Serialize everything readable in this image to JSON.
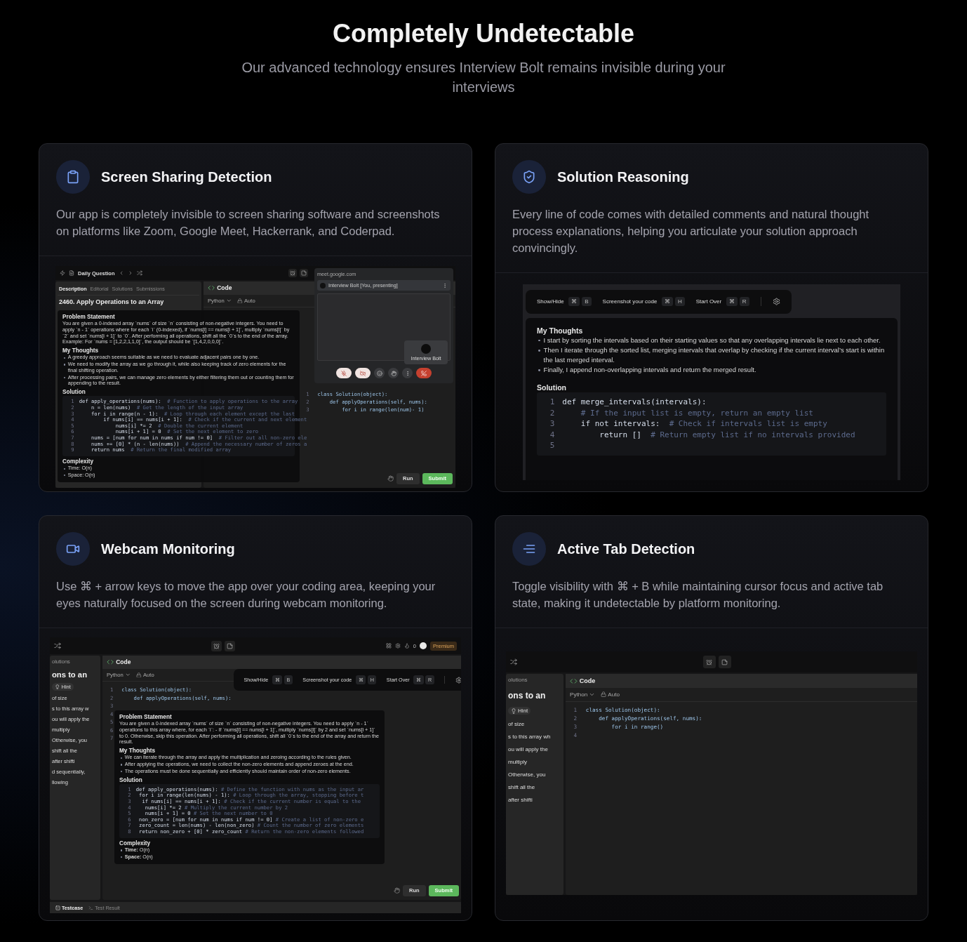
{
  "header": {
    "title": "Completely Undetectable",
    "subtitle": "Our advanced technology ensures Interview Bolt remains invisible during your interviews"
  },
  "cards": [
    {
      "title": "Screen Sharing Detection",
      "description": "Our app is completely invisible to screen sharing software and screenshots on platforms like Zoom, Google Meet, Hackerrank, and Coderpad.",
      "preview": {
        "kind": "meet",
        "app_title": "Daily Question",
        "tabs": [
          {
            "label": "Description",
            "selected": true
          },
          {
            "label": "Editorial",
            "selected": false
          },
          {
            "label": "Solutions",
            "selected": false
          },
          {
            "label": "Submissions",
            "selected": false
          }
        ],
        "problem_title": "2460. Apply Operations to an Array",
        "editor": {
          "title": "Code",
          "language": "Python",
          "mode": "Auto",
          "lines": [
            {
              "n": "1",
              "code": "class Solution(object):"
            },
            {
              "n": "2",
              "code": "    def applyOperations(self, nums):"
            },
            {
              "n": "3",
              "code": "        for i in range(len(num)- 1)"
            }
          ]
        },
        "sections": [
          {
            "kind": "text",
            "heading": "Problem Statement",
            "text": "You are given a 0-indexed array `nums` of size `n` consisting of non-negative integers. You need to apply `n - 1` operations where for each `i` (0-indexed), if `nums[i] == nums[i + 1]`, multiply `nums[i]` by `2` and set `nums[i + 1]` to `0`. After performing all operations, shift all the `0`s to the end of the array. Example: For `nums = [1,2,2,1,1,0]`, the output should be `[1,4,2,0,0,0]`."
          },
          {
            "kind": "bullets",
            "heading": "My Thoughts",
            "items": [
              "A greedy approach seems suitable as we need to evaluate adjacent pairs one by one.",
              "We need to modify the array as we go through it, while also keeping track of zero elements for the final shifting operation.",
              "After processing pairs, we can manage zero elements by either filtering them out or counting them for appending to the result."
            ]
          },
          {
            "kind": "code",
            "heading": "Solution",
            "lines": [
              {
                "n": "1",
                "code": "def apply_operations(nums):  ",
                "comment": "# Function to apply operations to the array"
              },
              {
                "n": "2",
                "code": "    n = len(nums)  ",
                "comment": "# Get the length of the input array"
              },
              {
                "n": "3",
                "code": "    for i in range(n - 1):  ",
                "comment": "# Loop through each element except the last"
              },
              {
                "n": "4",
                "code": "        if nums[i] == nums[i + 1]:  ",
                "comment": "# Check if the current and next element"
              },
              {
                "n": "5",
                "code": "            nums[i] *= 2  ",
                "comment": "# Double the current element"
              },
              {
                "n": "6",
                "code": "            nums[i + 1] = 0  ",
                "comment": "# Set the next element to zero"
              },
              {
                "n": "7",
                "code": "    nums = [num for num in nums if num != 0]  ",
                "comment": "# Filter out all non-zero ele"
              },
              {
                "n": "8",
                "code": "    nums += [0] * (n - len(nums))  ",
                "comment": "# Append the necessary number of zeros a"
              },
              {
                "n": "9",
                "code": "    return nums  ",
                "comment": "# Return the final modified array"
              }
            ]
          },
          {
            "kind": "bullets",
            "heading": "Complexity",
            "items": [
              "Time: O(n)",
              "Space: O(n)"
            ]
          }
        ],
        "meet": {
          "url": "meet.google.com",
          "presenting": "Interview Bolt [You, presenting]",
          "participant": "Interview Bolt"
        },
        "buttons": [
          {
            "label": "Run",
            "kind": "secondary"
          },
          {
            "label": "Submit",
            "kind": "primary"
          }
        ]
      }
    },
    {
      "title": "Solution Reasoning",
      "description": "Every line of code comes with detailed comments and natural thought process explanations, helping you articulate your solution approach convincingly.",
      "preview": {
        "kind": "reasoning",
        "shortcuts": [
          {
            "label": "Show/Hide",
            "keys": [
              "⌘",
              "B"
            ]
          },
          {
            "label": "Screenshot your code",
            "keys": [
              "⌘",
              "H"
            ]
          },
          {
            "label": "Start Over",
            "keys": [
              "⌘",
              "R"
            ]
          }
        ],
        "sections": [
          {
            "kind": "bullets",
            "heading": "My Thoughts",
            "items": [
              "I start by sorting the intervals based on their starting values so that any overlapping intervals lie next to each other.",
              "Then I iterate through the sorted list, merging intervals that overlap by checking if the current interval’s start is within the last merged interval.",
              "Finally, I append non-overlapping intervals and return the merged result."
            ]
          },
          {
            "kind": "code",
            "heading": "Solution",
            "lines": [
              {
                "n": "1",
                "code": "def merge_intervals(intervals):"
              },
              {
                "n": "2",
                "comment": "    # If the input list is empty, return an empty list"
              },
              {
                "n": "3",
                "code": "    if not intervals:  ",
                "comment": "# Check if intervals list is empty"
              },
              {
                "n": "4",
                "code": "        return []  ",
                "comment": "# Return empty list if no intervals provided"
              },
              {
                "n": "5"
              }
            ]
          }
        ]
      }
    },
    {
      "title": "Webcam Monitoring",
      "description": "Use ⌘ + arrow keys to move the app over your coding area, keeping your eyes naturally focused on the screen during webcam monitoring.",
      "preview": {
        "kind": "overlay",
        "count": "0",
        "premium": "Premium",
        "fragments": [
          {
            "kind": "tab",
            "text": "olutions"
          },
          {
            "kind": "heading",
            "text": "ons to an"
          },
          {
            "kind": "pill",
            "text": "Hint"
          },
          {
            "kind": "text",
            "text": "of size"
          },
          {
            "kind": "text",
            "text": "s to this array w"
          },
          {
            "kind": "text",
            "text": "ou will apply the"
          },
          {
            "kind": "text",
            "text": "multiply"
          },
          {
            "kind": "text",
            "text": "Otherwise, you"
          },
          {
            "kind": "text",
            "text": "shift all the"
          },
          {
            "kind": "text",
            "text": "after shifti"
          },
          {
            "kind": "text",
            "text": "d sequentially,"
          },
          {
            "kind": "text",
            "text": "llowing"
          }
        ],
        "editor": {
          "title": "Code",
          "language": "Python",
          "mode": "Auto",
          "lines": [
            {
              "n": "1",
              "code": "class Solution(object):"
            },
            {
              "n": "2",
              "code": "    def applyOperations(self, nums):"
            },
            {
              "n": "3"
            },
            {
              "n": "4"
            },
            {
              "n": "5"
            },
            {
              "n": "6"
            },
            {
              "n": "7"
            }
          ]
        },
        "shortcuts": [
          {
            "label": "Show/Hide",
            "keys": [
              "⌘",
              "B"
            ]
          },
          {
            "label": "Screenshot your code",
            "keys": [
              "⌘",
              "H"
            ]
          },
          {
            "label": "Start Over",
            "keys": [
              "⌘",
              "R"
            ]
          }
        ],
        "sections": [
          {
            "kind": "text",
            "heading": "Problem Statement",
            "text": "You are given a 0-indexed array `nums` of size `n` consisting of non-negative integers. You need to apply `n - 1` operations to this array where, for each `i`: - If `nums[i] == nums[i + 1]`, multiply `nums[i]` by 2 and set `nums[i + 1]` to 0. Otherwise, skip this operation. After performing all operations, shift all `0`s to the end of the array and return the result."
          },
          {
            "kind": "bullets",
            "heading": "My Thoughts",
            "items": [
              "We can iterate through the array and apply the multiplication and zeroing according to the rules given.",
              "After applying the operations, we need to collect the non-zero elements and append zeroes at the end.",
              "The operations must be done sequentially and efficiently should maintain order of non-zero elements."
            ]
          },
          {
            "kind": "code",
            "heading": "Solution",
            "lines": [
              {
                "n": "1",
                "code": "def apply_operations(nums): ",
                "comment": "# Define the function with nums as the input ar"
              },
              {
                "n": "2",
                "code": " for i in range(len(nums) - 1): ",
                "comment": "# Loop through the array, stopping before t"
              },
              {
                "n": "3",
                "code": "  if nums[i] == nums[i + 1]: ",
                "comment": "# Check if the current number is equal to the"
              },
              {
                "n": "4",
                "code": "   nums[i] *= 2 ",
                "comment": "# Multiply the current number by 2"
              },
              {
                "n": "5",
                "code": "   nums[i + 1] = 0 ",
                "comment": "# Set the next number to 0"
              },
              {
                "n": "6",
                "code": " non_zero = [num for num in nums if num != 0] ",
                "comment": "# Create a list of non-zero e"
              },
              {
                "n": "7",
                "code": " zero_count = len(nums) - len(non_zero) ",
                "comment": "# Count the number of zero elements"
              },
              {
                "n": "8",
                "code": " return non_zero + [0] * zero_count ",
                "comment": "# Return the non-zero elements followed"
              }
            ]
          },
          {
            "kind": "bullets",
            "heading": "Complexity",
            "items": [
              "**Time:** O(n)",
              "**Space:** O(n)"
            ]
          }
        ],
        "buttons": [
          {
            "label": "Run",
            "kind": "secondary"
          },
          {
            "label": "Submit",
            "kind": "primary"
          }
        ],
        "bottom_tabs": [
          {
            "label": "Testcase",
            "selected": true
          },
          {
            "label": "Test Result",
            "selected": false
          }
        ]
      }
    },
    {
      "title": "Active Tab Detection",
      "description": "Toggle visibility with ⌘ + B while maintaining cursor focus and active tab state, making it undetectable by platform monitoring.",
      "preview": {
        "kind": "editor",
        "fragments": [
          {
            "kind": "tab",
            "text": "olutions"
          },
          {
            "kind": "heading",
            "text": "ons to an"
          },
          {
            "kind": "pill",
            "text": "Hint"
          },
          {
            "kind": "text",
            "text": "of size"
          },
          {
            "kind": "text",
            "text": "s to this array wh"
          },
          {
            "kind": "text",
            "text": "ou will apply the"
          },
          {
            "kind": "text",
            "text": "multiply"
          },
          {
            "kind": "text",
            "text": "Otherwise, you"
          },
          {
            "kind": "text",
            "text": "shift all the"
          },
          {
            "kind": "text",
            "text": "after shifti"
          }
        ],
        "editor": {
          "title": "Code",
          "language": "Python",
          "mode": "Auto",
          "lines": [
            {
              "n": "1",
              "code": "class Solution(object):"
            },
            {
              "n": "2",
              "code": "    def applyOperations(self, nums):"
            },
            {
              "n": "3",
              "code": "        for i in range()"
            },
            {
              "n": "4"
            }
          ]
        }
      }
    }
  ]
}
